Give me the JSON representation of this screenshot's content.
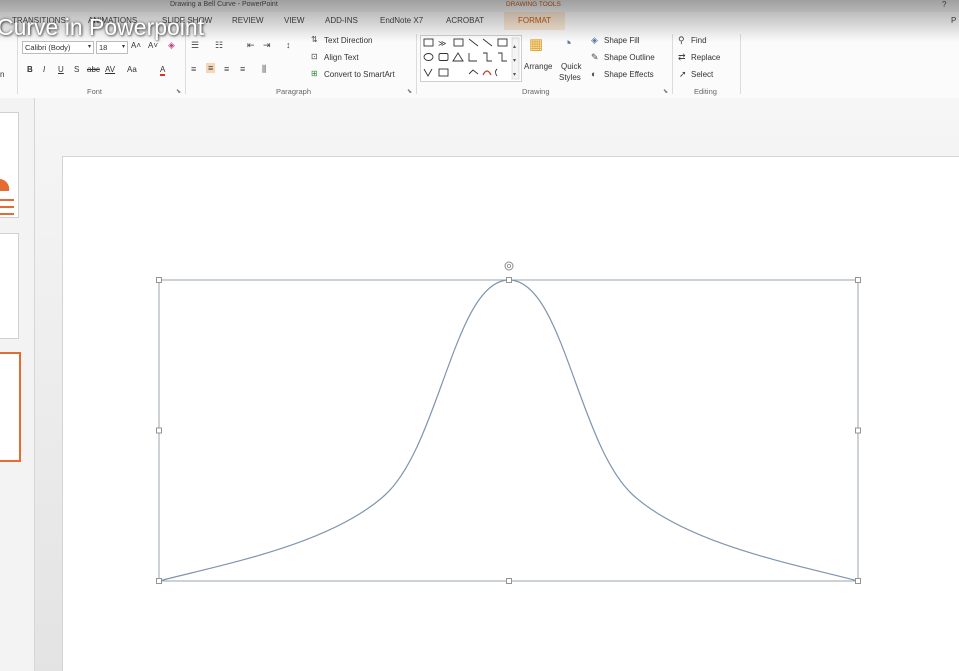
{
  "window": {
    "title": "Drawing a Bell Curve - PowerPoint",
    "contextual_group": "DRAWING TOOLS",
    "help": "?"
  },
  "video_title": "Curve in Powerpoint",
  "tabs": {
    "transitions": "TRANSITIONS",
    "animations": "ANIMATIONS",
    "slideshow": "SLIDE SHOW",
    "review": "REVIEW",
    "view": "VIEW",
    "addins": "ADD-INS",
    "endnote": "EndNote X7",
    "acrobat": "ACROBAT",
    "format": "FORMAT",
    "right_cut": "P"
  },
  "ribbon": {
    "font": {
      "family": "Calibri (Body)",
      "size": "18",
      "label": "Font",
      "bold": "B",
      "italic": "I",
      "underline": "U",
      "shadow": "S",
      "strike": "abc",
      "spacing": "AV",
      "case": "Aa",
      "grow": "A˄",
      "shrink": "A˅",
      "color": "A"
    },
    "left_cut": "n",
    "paragraph": {
      "label": "Paragraph",
      "text_direction": "Text Direction",
      "align_text": "Align Text",
      "convert_smartart": "Convert to SmartArt"
    },
    "drawing": {
      "label": "Drawing",
      "arrange": "Arrange",
      "quick_styles_1": "Quick",
      "quick_styles_2": "Styles",
      "shape_fill": "Shape Fill",
      "shape_outline": "Shape Outline",
      "shape_effects": "Shape Effects"
    },
    "editing": {
      "label": "Editing",
      "find": "Find",
      "replace": "Replace",
      "select": "Select"
    }
  },
  "slide": {
    "shape": "bell-curve"
  }
}
